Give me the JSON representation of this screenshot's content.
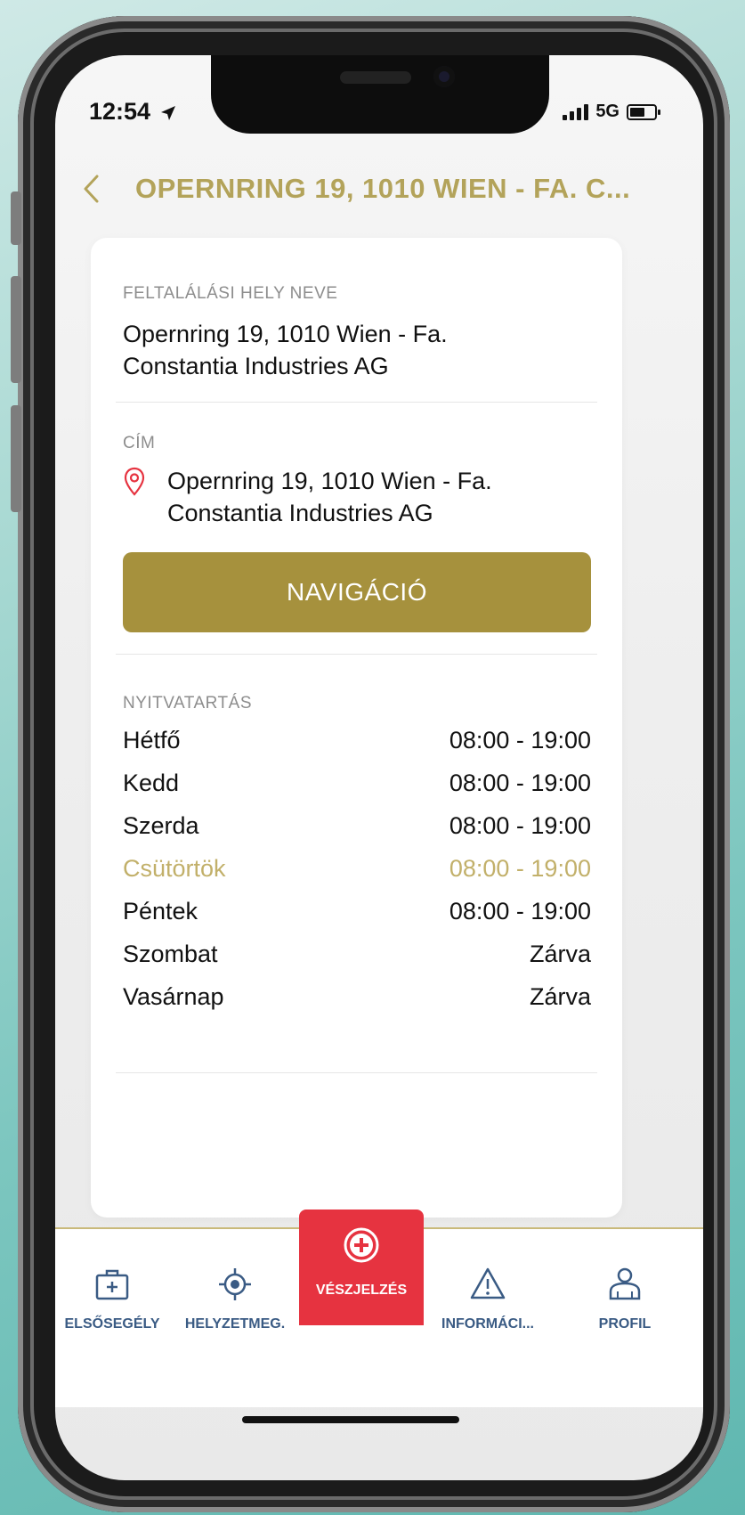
{
  "status_bar": {
    "time": "12:54",
    "network": "5G"
  },
  "header": {
    "title": "OPERNRING 19, 1010 WIEN - FA. C..."
  },
  "location": {
    "name_label": "FELTALÁLÁSI HELY NEVE",
    "name_line1": "Opernring 19, 1010 Wien - Fa.",
    "name_line2": "Constantia Industries AG",
    "address_label": "CÍM",
    "address_line1": "Opernring 19, 1010 Wien - Fa.",
    "address_line2": "Constantia Industries AG",
    "nav_button": "NAVIGÁCIÓ"
  },
  "opening_hours": {
    "label": "NYITVATARTÁS",
    "days": [
      {
        "day": "Hétfő",
        "hours": "08:00 - 19:00",
        "today": false
      },
      {
        "day": "Kedd",
        "hours": "08:00 - 19:00",
        "today": false
      },
      {
        "day": "Szerda",
        "hours": "08:00 - 19:00",
        "today": false
      },
      {
        "day": "Csütörtök",
        "hours": "08:00 - 19:00",
        "today": true
      },
      {
        "day": "Péntek",
        "hours": "08:00 - 19:00",
        "today": false
      },
      {
        "day": "Szombat",
        "hours": "Zárva",
        "today": false
      },
      {
        "day": "Vasárnap",
        "hours": "Zárva",
        "today": false
      }
    ]
  },
  "tabbar": {
    "items": [
      {
        "label": "ELSŐSEGÉLY",
        "icon": "first-aid-kit-icon",
        "active": false
      },
      {
        "label": "HELYZETMEG.",
        "icon": "crosshair-location-icon",
        "active": false
      },
      {
        "label": "VÉSZJELZÉS",
        "icon": "emergency-plus-icon",
        "active": true
      },
      {
        "label": "INFORMÁCI...",
        "icon": "warning-triangle-icon",
        "active": false
      },
      {
        "label": "PROFIL",
        "icon": "user-profile-icon",
        "active": false
      }
    ]
  },
  "colors": {
    "accent_gold": "#a6913d",
    "title_gold": "#b3a35a",
    "today_highlight": "#c2b06a",
    "emergency_red": "#e63340",
    "tab_label_blue": "#3a5b84"
  }
}
